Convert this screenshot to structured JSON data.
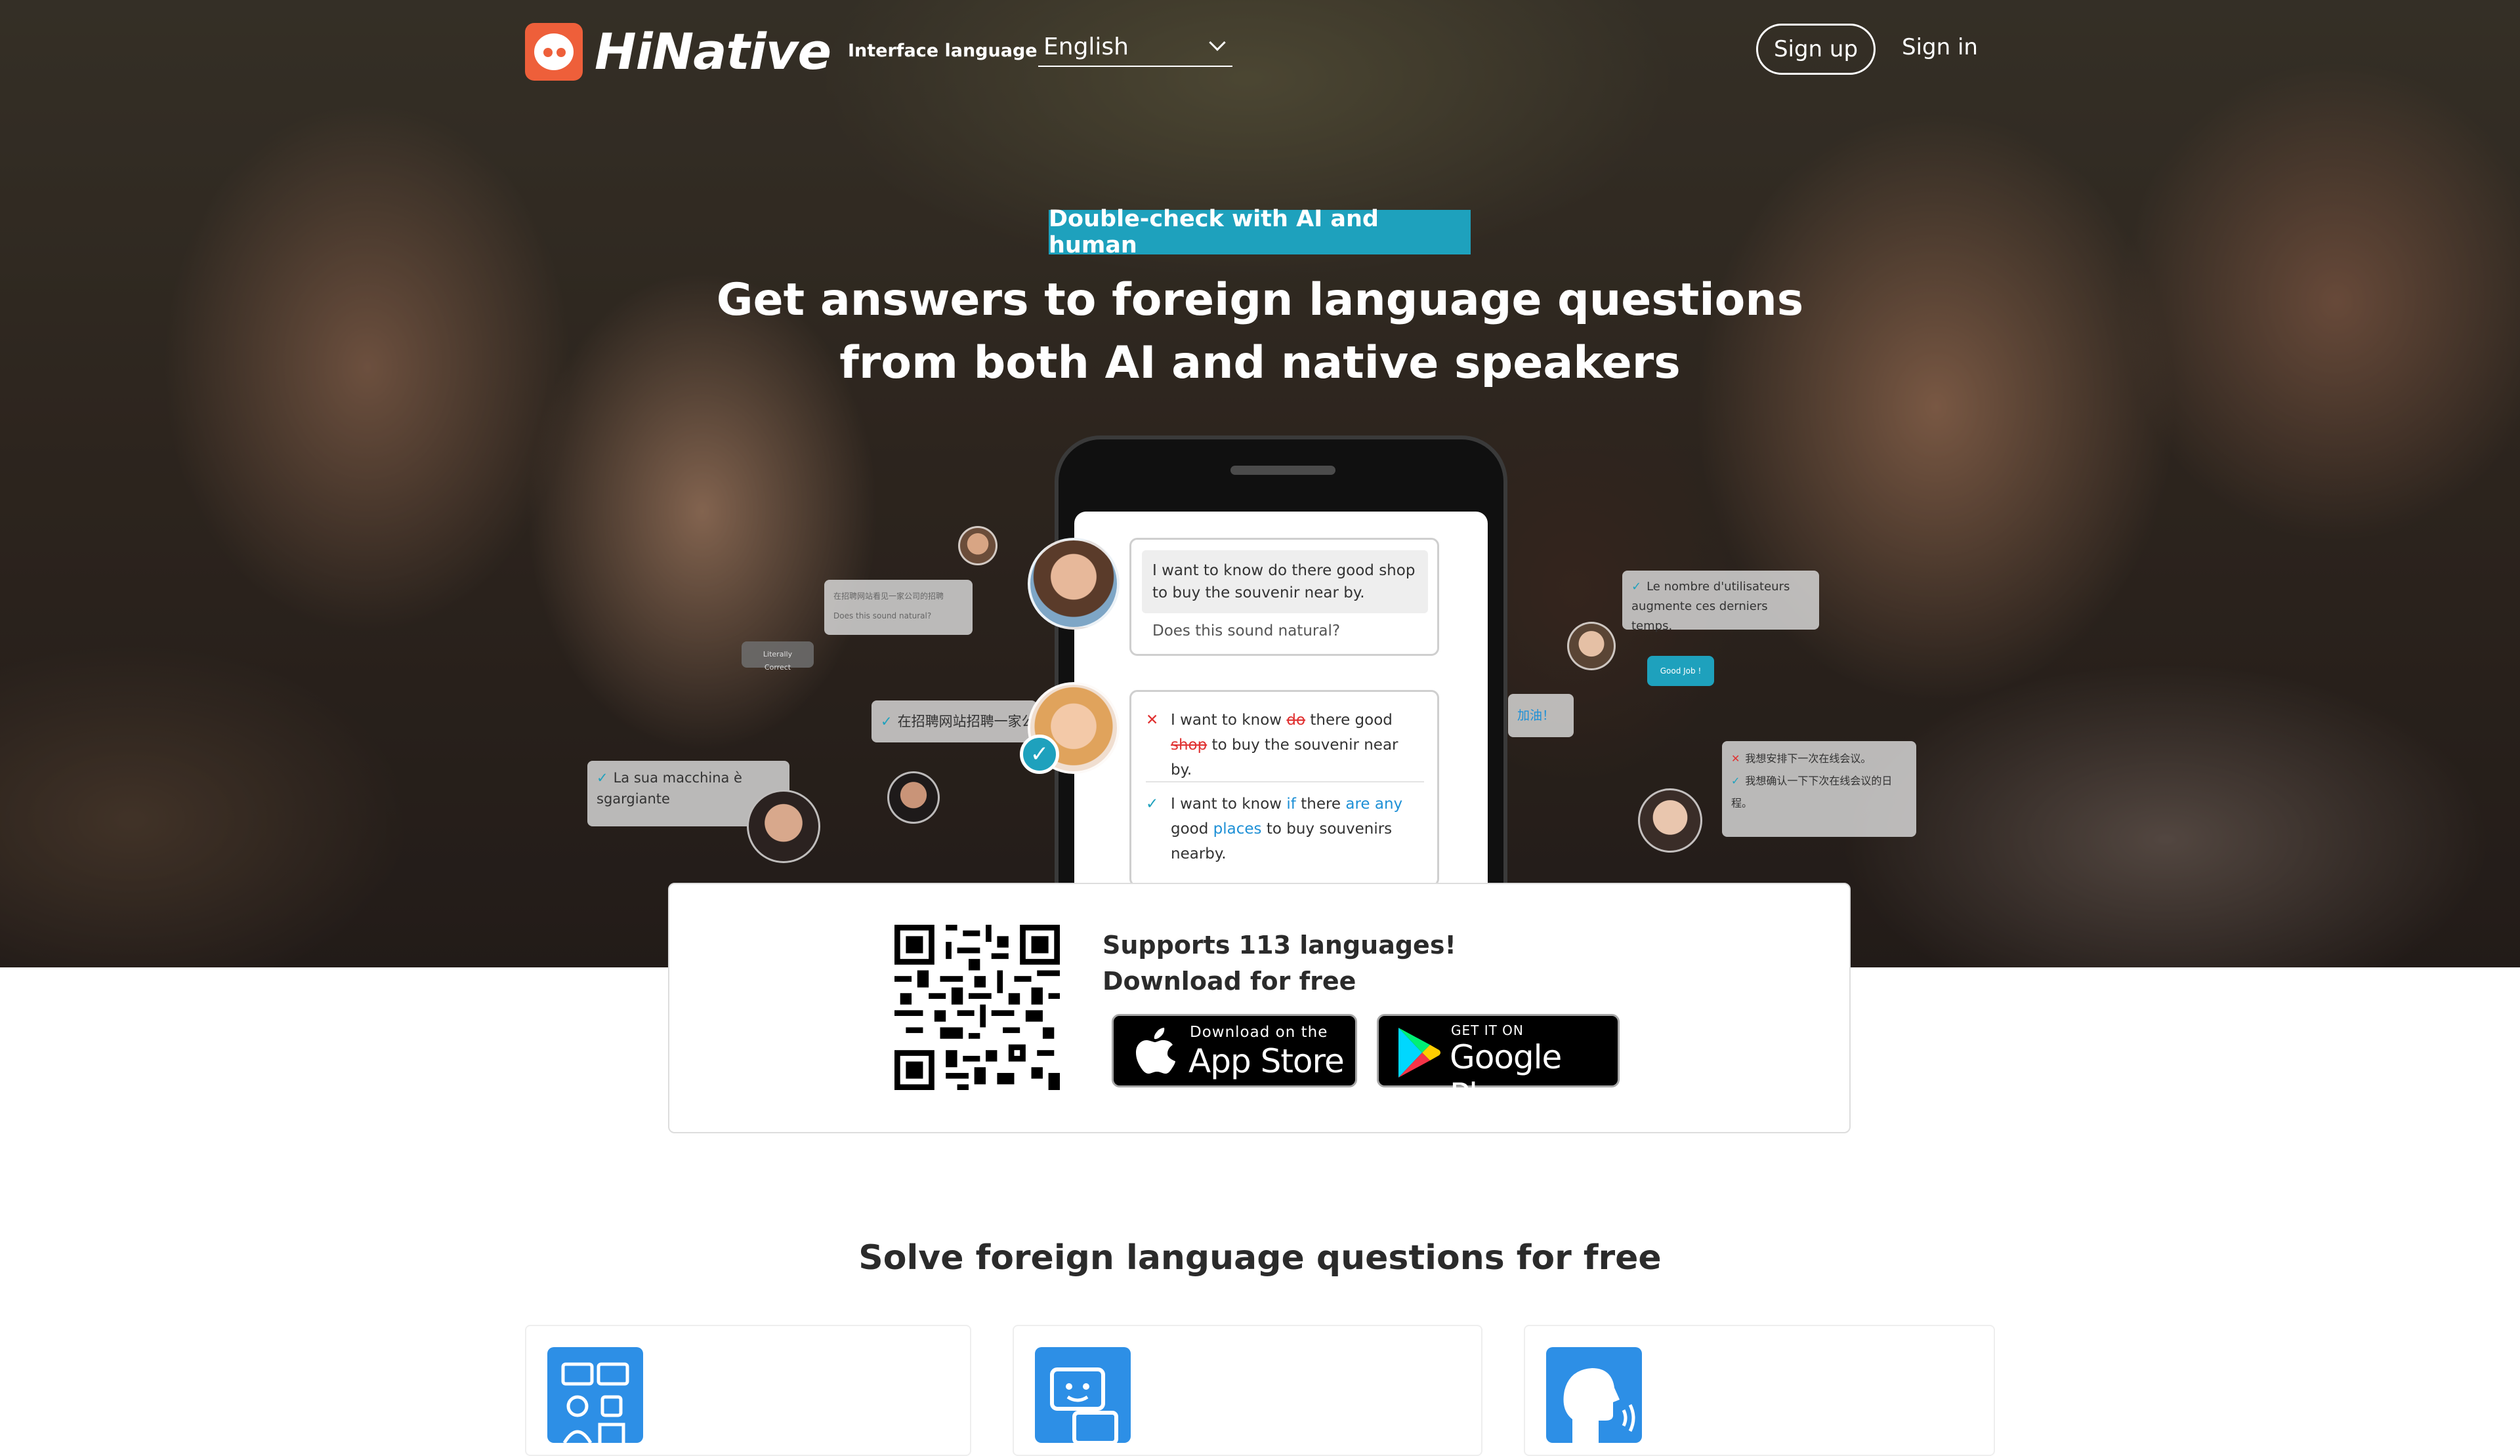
{
  "header": {
    "logo_text": "HiNative",
    "interface_language_label": "Interface language",
    "language_value": "English",
    "sign_up": "Sign up",
    "sign_in": "Sign in"
  },
  "hero": {
    "tagline": "Double-check with AI and human",
    "headline_line1": "Get answers to foreign language questions",
    "headline_line2": "from both AI and native speakers"
  },
  "phone": {
    "question": "I want to know do there good shop to buy the souvenir near by.",
    "question_sub": "Does this sound natural?",
    "wrong": {
      "p1": "I want to know ",
      "del1": "do",
      "p2": " there good ",
      "del2": "shop",
      "p3": " to buy the souvenir near by."
    },
    "right": {
      "p1": "I want to know ",
      "ins1": "if",
      "p2": " there ",
      "ins2": "are any",
      "p3": " good ",
      "ins3": "places",
      "p4": " to buy souvenirs nearby."
    }
  },
  "bubbles": {
    "b1_line1": "在招聘网站看见一家公司的招聘",
    "b1_line2": "Does this sound natural?",
    "b2": "Literally Correct",
    "b3": "在招聘网站招聘一家公司",
    "b4": "La sua macchina è sgargiante",
    "b5": "Le nombre d'utilisateurs augmente ces derniers temps.",
    "b6": "Good Job !",
    "b7": "加油！",
    "b8_line1": "我想安排下一次在线会议。",
    "b8_line2": "我想确认一下下次在线会议的日程。"
  },
  "download": {
    "title_line1": "Supports 113 languages!",
    "title_line2": "Download for free",
    "appstore_small": "Download on the",
    "appstore_big": "App Store",
    "gplay_small": "GET IT ON",
    "gplay_big": "Google Play"
  },
  "section": {
    "title": "Solve foreign language questions for free"
  },
  "colors": {
    "accent": "#1ea1bd",
    "brand": "#ee5f3a",
    "feature_icon_bg": "#2d8fe6"
  }
}
